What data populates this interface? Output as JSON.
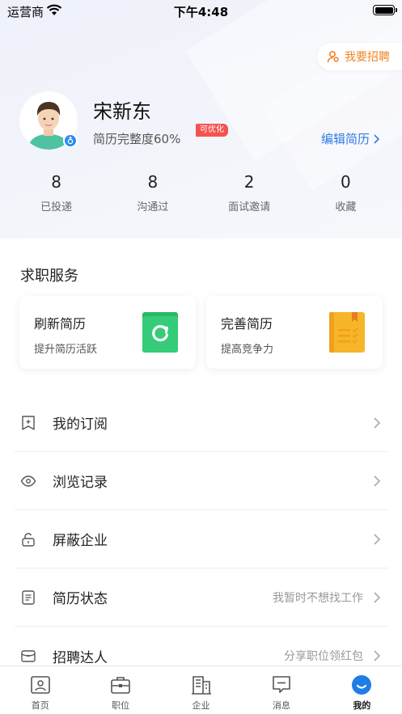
{
  "status_bar": {
    "carrier": "运营商",
    "time": "下午4:48"
  },
  "header": {
    "recruit_label": "我要招聘",
    "user_name": "宋新东",
    "completeness": "简历完整度60%",
    "optimize_badge": "可优化",
    "edit_resume": "编辑简历"
  },
  "stats": [
    {
      "value": "8",
      "label": "已投递"
    },
    {
      "value": "8",
      "label": "沟通过"
    },
    {
      "value": "2",
      "label": "面试邀请"
    },
    {
      "value": "0",
      "label": "收藏"
    }
  ],
  "services": {
    "title": "求职服务",
    "cards": [
      {
        "title": "刷新简历",
        "subtitle": "提升简历活跃",
        "icon": "refresh-icon",
        "color": "#2ec472"
      },
      {
        "title": "完善简历",
        "subtitle": "提高竞争力",
        "icon": "book-icon",
        "color": "#f7b52a"
      }
    ]
  },
  "menu": [
    {
      "label": "我的订阅",
      "value": "",
      "icon": "bookmark-icon"
    },
    {
      "label": "浏览记录",
      "value": "",
      "icon": "eye-icon"
    },
    {
      "label": "屏蔽企业",
      "value": "",
      "icon": "lock-icon"
    },
    {
      "label": "简历状态",
      "value": "我暂时不想找工作",
      "icon": "document-icon"
    },
    {
      "label": "招聘达人",
      "value": "分享职位领红包",
      "icon": "wallet-icon"
    }
  ],
  "tabbar": [
    {
      "label": "首页",
      "icon": "home-icon"
    },
    {
      "label": "职位",
      "icon": "briefcase-icon"
    },
    {
      "label": "企业",
      "icon": "building-icon"
    },
    {
      "label": "消息",
      "icon": "message-icon"
    },
    {
      "label": "我的",
      "icon": "profile-icon",
      "active": true
    }
  ],
  "colors": {
    "accent_blue": "#2f7ae5",
    "accent_orange": "#f0841f",
    "badge_red": "#f4534f"
  }
}
